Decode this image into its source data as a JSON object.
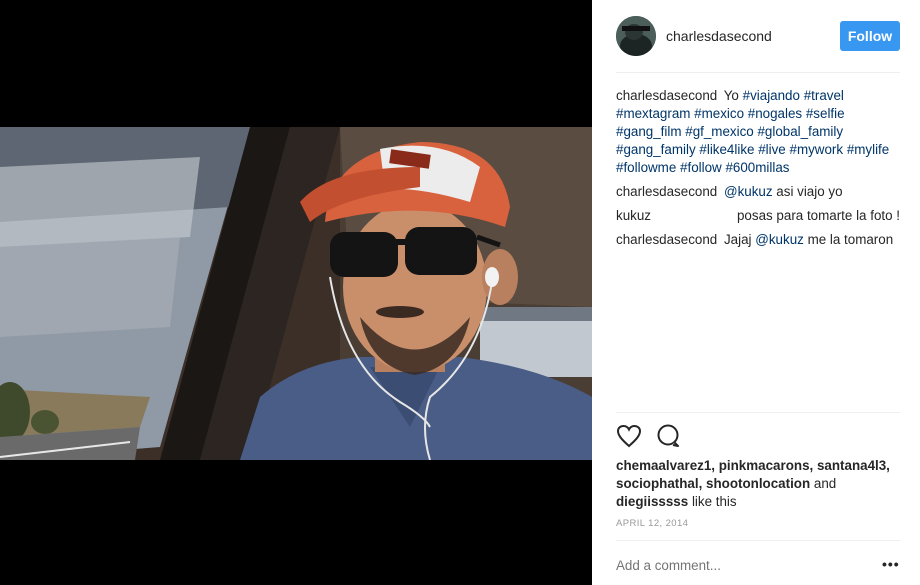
{
  "post": {
    "username": "charlesdasecond",
    "follow_label": "Follow"
  },
  "caption": {
    "username": "charlesdasecond",
    "text_prefix": "Yo",
    "hashtags": [
      "#viajando",
      "#travel",
      "#mextagram",
      "#mexico",
      "#nogales",
      "#selfie",
      "#gang_film",
      "#gf_mexico",
      "#global_family",
      "#gang_family",
      "#like4like",
      "#live",
      "#mywork",
      "#mylife",
      "#followme",
      "#follow",
      "#600millas"
    ]
  },
  "comments": [
    {
      "user": "charlesdasecond",
      "mention": "@kukuz",
      "text": "asi viajo yo"
    },
    {
      "user": "kukuz",
      "text": "posas para tomarte la foto !"
    },
    {
      "user": "charlesdasecond",
      "text_before": "Jajaj",
      "mention": "@kukuz",
      "text": "me la tomaron"
    }
  ],
  "likes": {
    "names_line1": "chemaalvarez1, pinkmacarons, santana4l3,",
    "names_line2": "sociophathal, shootonlocation",
    "and_word": "and",
    "last_name": "diegiisssss",
    "suffix": "like this"
  },
  "date": "APRIL 12, 2014",
  "add_comment_placeholder": "Add a comment...",
  "more_label": "•••",
  "icons": {
    "like": "heart-icon",
    "comment": "comment-icon"
  },
  "colors": {
    "follow_button": "#3897f0",
    "hashtag": "#003569",
    "divider": "#efefef",
    "muted": "#999999"
  }
}
